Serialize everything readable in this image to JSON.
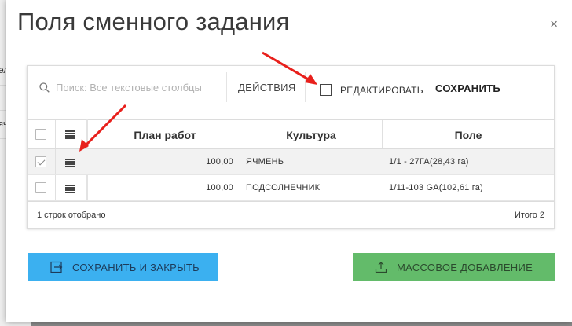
{
  "background": {
    "fragment_1": "ел",
    "fragment_2": "яч"
  },
  "modal": {
    "title": "Поля сменного задания",
    "close_glyph": "×"
  },
  "toolbar": {
    "search_placeholder": "Поиск: Все текстовые столбцы",
    "actions_label": "ДЕЙСТВИЯ",
    "edit_label": "РЕДАКТИРОВАТЬ",
    "edit_checked": false,
    "save_label": "СОХРАНИТЬ"
  },
  "table": {
    "columns": [
      "План работ",
      "Культура",
      "Поле"
    ],
    "rows": [
      {
        "selected": true,
        "plan": "100,00",
        "culture": "ЯЧМЕНЬ",
        "field": "1/1 - 27ГА(28,43 га)"
      },
      {
        "selected": false,
        "plan": "100,00",
        "culture": "ПОДСОЛНЕЧНИК",
        "field": "1/11-103 GA(102,61 га)"
      }
    ],
    "footer_left": "1 строк отобрано",
    "footer_right": "Итого 2"
  },
  "buttons": {
    "save_close": "СОХРАНИТЬ И ЗАКРЫТЬ",
    "mass_add": "МАССОВОЕ ДОБАВЛЕНИЕ"
  },
  "icons": {
    "search": "search-icon",
    "menu": "menu-lines-icon",
    "save_close": "exit-to-app-icon",
    "mass_add": "upload-icon"
  },
  "colors": {
    "primary": "#3bb0f0",
    "success": "#63bb6a",
    "annotation_arrow": "#e8201c"
  }
}
